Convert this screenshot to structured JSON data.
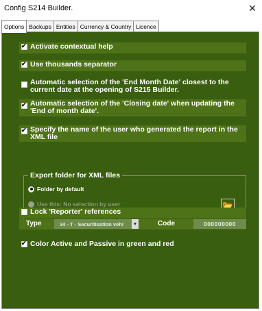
{
  "window": {
    "title": "Config S214 Builder.",
    "close_glyph": "✕"
  },
  "tabs": [
    {
      "label": "Options",
      "active": true
    },
    {
      "label": "Backups",
      "active": false
    },
    {
      "label": "Entities",
      "active": false
    },
    {
      "label": "Currency & Country",
      "active": false
    },
    {
      "label": "Licence",
      "active": false
    }
  ],
  "options": {
    "contextual_help": {
      "label": "Activate contextual help",
      "checked": true
    },
    "thousands_separator": {
      "label": "Use thousands separator",
      "checked": true
    },
    "auto_end_month": {
      "line1": "Automatic selection of the 'End Month Date' closest to the",
      "line2": "current date at the opening of S215 Builder.",
      "checked": false
    },
    "auto_closing_date": {
      "line1": "Automatic selection of the 'Closing date' when updating the",
      "line2": "'End of month date'.",
      "checked": true
    },
    "specify_user": {
      "line1": "Specify the name of the user who generated the report in the",
      "line2": "XML file",
      "checked": true
    },
    "lock_reporter": {
      "label": "Lock 'Reporter' references",
      "checked": false
    },
    "color_active_passive": {
      "label": "Color Active and Passive in green and red",
      "checked": true
    }
  },
  "export": {
    "legend": "Export folder for XML files",
    "radio_default": {
      "label": "Folder by default",
      "selected": true
    },
    "radio_use_this": {
      "label": "Use this: No selection by user",
      "selected": false
    }
  },
  "reporter": {
    "type_label": "Type",
    "type_value": "34 - T - Securitisation vehi",
    "code_label": "Code",
    "code_value": "000000000"
  },
  "icons": {
    "check": "✔",
    "dropdown": "▼",
    "folder": "folder-open-icon"
  },
  "colors": {
    "panel_bg": "#3a5e10",
    "option_band": "#4e7217",
    "disabled_field": "#6e8c4c"
  }
}
